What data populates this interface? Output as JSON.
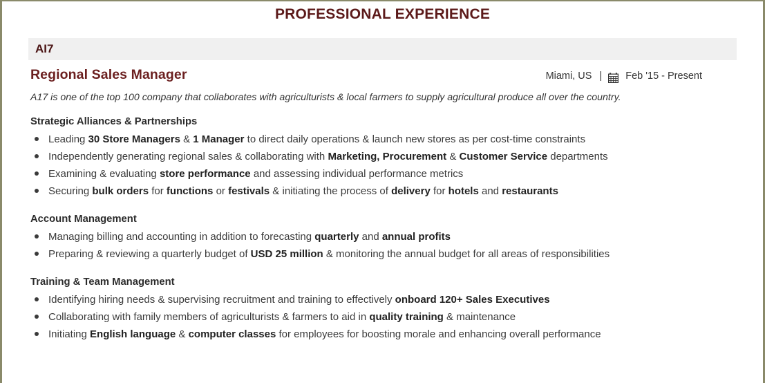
{
  "section": {
    "title": "PROFESSIONAL EXPERIENCE",
    "title_color": "#5c1a1a"
  },
  "company": {
    "name": "AI7",
    "bar_color": "#f0f0f0",
    "description": "A17 is one of the top 100 company that collaborates with agriculturists & local farmers to supply agricultural produce all over the country."
  },
  "role": {
    "title": "Regional Sales Manager",
    "title_color": "#6b1f1f",
    "location": "Miami, US",
    "separator": "|",
    "calendar_icon": "calendar-icon",
    "dates": "Feb '15 -  Present"
  },
  "blocks": [
    {
      "heading": "Strategic Alliances & Partnerships",
      "bullets": [
        [
          {
            "t": "Leading ",
            "b": false
          },
          {
            "t": "30 Store Managers",
            "b": true
          },
          {
            "t": " & ",
            "b": false
          },
          {
            "t": "1 Manager",
            "b": true
          },
          {
            "t": " to direct daily operations & launch new stores as per cost-time constraints",
            "b": false
          }
        ],
        [
          {
            "t": "Independently generating regional sales & collaborating with ",
            "b": false
          },
          {
            "t": "Marketing, Procurement",
            "b": true
          },
          {
            "t": " & ",
            "b": false
          },
          {
            "t": "Customer Service",
            "b": true
          },
          {
            "t": " departments",
            "b": false
          }
        ],
        [
          {
            "t": "Examining & evaluating ",
            "b": false
          },
          {
            "t": "store performance",
            "b": true
          },
          {
            "t": " and assessing individual performance metrics",
            "b": false
          }
        ],
        [
          {
            "t": "Securing ",
            "b": false
          },
          {
            "t": "bulk orders",
            "b": true
          },
          {
            "t": " for ",
            "b": false
          },
          {
            "t": "functions",
            "b": true
          },
          {
            "t": " or ",
            "b": false
          },
          {
            "t": "festivals",
            "b": true
          },
          {
            "t": " & initiating the process of ",
            "b": false
          },
          {
            "t": "delivery",
            "b": true
          },
          {
            "t": " for ",
            "b": false
          },
          {
            "t": "hotels",
            "b": true
          },
          {
            "t": " and ",
            "b": false
          },
          {
            "t": "restaurants",
            "b": true
          }
        ]
      ]
    },
    {
      "heading": "Account Management",
      "bullets": [
        [
          {
            "t": "Managing billing and accounting in addition to forecasting ",
            "b": false
          },
          {
            "t": "quarterly",
            "b": true
          },
          {
            "t": " and ",
            "b": false
          },
          {
            "t": "annual profits",
            "b": true
          }
        ],
        [
          {
            "t": "Preparing & reviewing a quarterly budget of ",
            "b": false
          },
          {
            "t": "USD 25 million",
            "b": true
          },
          {
            "t": " & monitoring the annual budget for all areas of responsibilities",
            "b": false
          }
        ]
      ]
    },
    {
      "heading": "Training & Team Management",
      "bullets": [
        [
          {
            "t": "Identifying hiring needs & supervising recruitment and training to effectively ",
            "b": false
          },
          {
            "t": "onboard 120+ Sales Executives",
            "b": true
          }
        ],
        [
          {
            "t": "Collaborating with family members of agriculturists & farmers to aid in ",
            "b": false
          },
          {
            "t": "quality training",
            "b": true
          },
          {
            "t": " & maintenance",
            "b": false
          }
        ],
        [
          {
            "t": "Initiating ",
            "b": false
          },
          {
            "t": "English language",
            "b": true
          },
          {
            "t": " & ",
            "b": false
          },
          {
            "t": "computer classes",
            "b": true
          },
          {
            "t": " for employees for boosting morale and enhancing overall performance",
            "b": false
          }
        ]
      ]
    }
  ]
}
